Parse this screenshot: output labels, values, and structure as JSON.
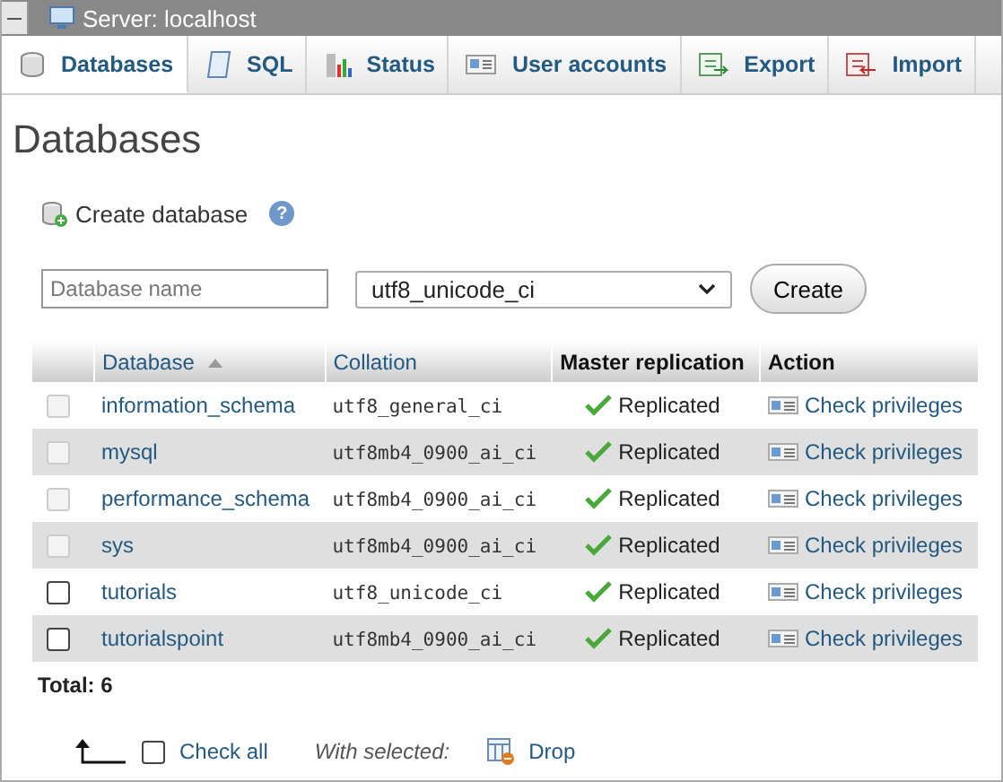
{
  "server_bar": {
    "title": "Server: localhost"
  },
  "tabs": [
    {
      "label": "Databases",
      "selected": true
    },
    {
      "label": "SQL",
      "selected": false
    },
    {
      "label": "Status",
      "selected": false
    },
    {
      "label": "User accounts",
      "selected": false
    },
    {
      "label": "Export",
      "selected": false
    },
    {
      "label": "Import",
      "selected": false
    }
  ],
  "page_title": "Databases",
  "create": {
    "heading": "Create database",
    "help": "?",
    "name_field": {
      "placeholder": "Database name"
    },
    "collation_select": {
      "value": "utf8_unicode_ci"
    },
    "button": "Create"
  },
  "table": {
    "columns": [
      {
        "label": "Database",
        "sortable": true
      },
      {
        "label": "Collation",
        "sortable": true
      },
      {
        "label": "Master replication",
        "sortable": false
      },
      {
        "label": "Action",
        "sortable": false
      }
    ],
    "rows": [
      {
        "database": "information_schema",
        "collation": "utf8_general_ci",
        "replication": "Replicated",
        "action": "Check privileges",
        "checked": false,
        "disabled": true
      },
      {
        "database": "mysql",
        "collation": "utf8mb4_0900_ai_ci",
        "replication": "Replicated",
        "action": "Check privileges",
        "checked": false,
        "disabled": true
      },
      {
        "database": "performance_schema",
        "collation": "utf8mb4_0900_ai_ci",
        "replication": "Replicated",
        "action": "Check privileges",
        "checked": false,
        "disabled": true
      },
      {
        "database": "sys",
        "collation": "utf8mb4_0900_ai_ci",
        "replication": "Replicated",
        "action": "Check privileges",
        "checked": false,
        "disabled": true
      },
      {
        "database": "tutorials",
        "collation": "utf8_unicode_ci",
        "replication": "Replicated",
        "action": "Check privileges",
        "checked": false,
        "disabled": false
      },
      {
        "database": "tutorialspoint",
        "collation": "utf8mb4_0900_ai_ci",
        "replication": "Replicated",
        "action": "Check privileges",
        "checked": false,
        "disabled": false
      }
    ],
    "total": "Total: 6"
  },
  "footer": {
    "check_all": {
      "label": "Check all",
      "checked": false
    },
    "with_selected": "With selected:",
    "drop": "Drop"
  }
}
